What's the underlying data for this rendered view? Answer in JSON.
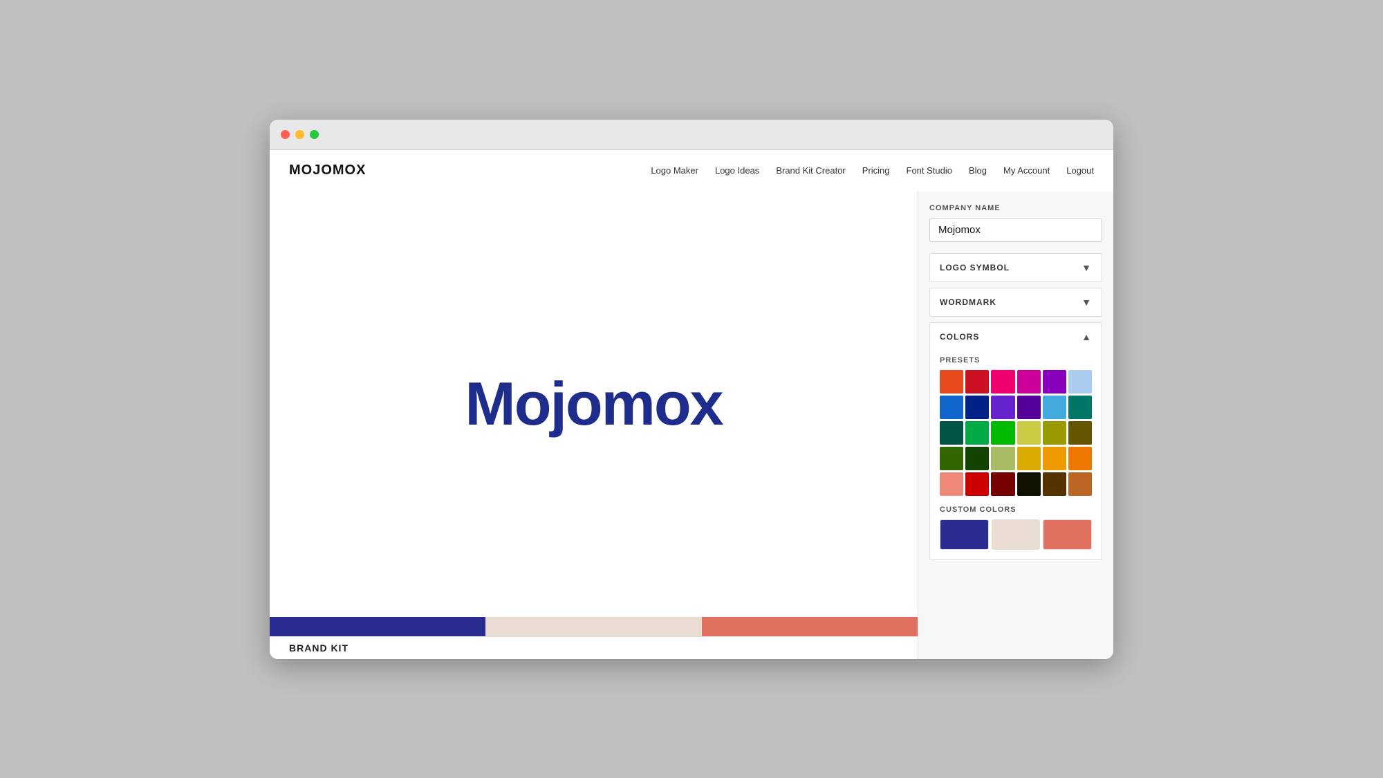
{
  "browser": {
    "dots": [
      "red",
      "yellow",
      "green"
    ]
  },
  "nav": {
    "logo": "MOJOMOX",
    "links": [
      {
        "label": "Logo Maker",
        "id": "logo-maker"
      },
      {
        "label": "Logo Ideas",
        "id": "logo-ideas"
      },
      {
        "label": "Brand Kit Creator",
        "id": "brand-kit-creator"
      },
      {
        "label": "Pricing",
        "id": "pricing"
      },
      {
        "label": "Font Studio",
        "id": "font-studio"
      },
      {
        "label": "Blog",
        "id": "blog"
      },
      {
        "label": "My Account",
        "id": "my-account"
      },
      {
        "label": "Logout",
        "id": "logout"
      }
    ]
  },
  "sidebar": {
    "company_name_label": "COMPANY NAME",
    "company_name_value": "Mojomox",
    "logo_symbol_label": "LOGO SYMBOL",
    "wordmark_label": "WORDMARK",
    "colors_label": "COLORS",
    "presets_label": "PRESETS",
    "custom_colors_label": "CUSTOM COLORS"
  },
  "color_presets": [
    "#e84c1e",
    "#cc1122",
    "#f0006e",
    "#cc0099",
    "#8800bb",
    "#aaccee",
    "#1166cc",
    "#002288",
    "#6622cc",
    "#550099",
    "#44aadd",
    "#007766",
    "#005544",
    "#00aa44",
    "#00bb00",
    "#cccc44",
    "#999900",
    "#665500",
    "#336600",
    "#114400",
    "#aabb66",
    "#ddaa00",
    "#ee9900",
    "#ee7700",
    "#ee8877",
    "#cc0000",
    "#770000",
    "#111100",
    "#553300",
    "#bb6622"
  ],
  "custom_colors": [
    "#2a2d8f",
    "#e8ddd0",
    "#e07060"
  ],
  "canvas": {
    "logo_text": "Mojomox",
    "brand_kit_label": "BRAND KIT"
  }
}
